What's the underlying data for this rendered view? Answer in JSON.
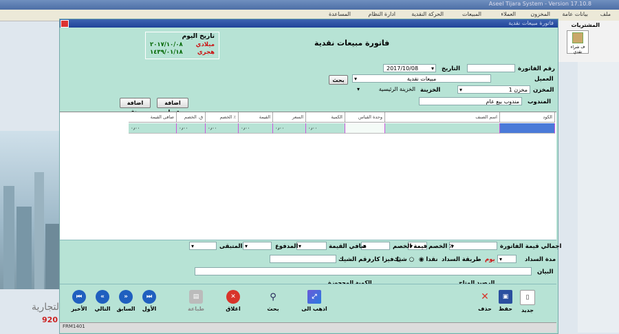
{
  "bg": {
    "title": "Aseel Tijara System - Version 17.10.8",
    "menu": [
      "ملف",
      "بيانات عامة",
      "المخزون",
      "العملاء",
      "المبيعات",
      "الحركة النقدية",
      "ادارة النظام",
      "المساعدة"
    ],
    "toolbar_label": "المشتريات",
    "toolbar_btn": "ف شراء نقدي",
    "brand_text": "لتجارية",
    "brand_phone": "920"
  },
  "dialog": {
    "caption": "فاتورة مبيعات نقدية",
    "title": "فاتورة مبيعات نقدية",
    "today": {
      "label": "تاريخ اليوم",
      "greg_label": "ميلادي",
      "greg_date": "٢٠١٧/١٠/٠٨",
      "hijri_label": "هجري",
      "hijri_date": "١٤٣٩/٠١/١٨"
    },
    "form": {
      "invoice_no_label": "رقم الفاتورة",
      "invoice_no": "",
      "date_label": "التاريخ",
      "date_value": "2017/10/08",
      "customer_label": "العميل",
      "customer_value": "مبيعات نقدية",
      "search_btn": "بحث",
      "store_label": "المخزن",
      "store_value": "مخزن 1",
      "treasury_label": "الخزينة",
      "treasury_value": "الخزينة الرئيسية",
      "rep_label": "المندوب",
      "rep_value": "مندوب بيع عام",
      "add_customer_btn": "اضافة عميل",
      "add_item_btn": "اضافة صنف"
    },
    "grid": {
      "headers": [
        "الكود",
        "اسم الصنف",
        "وحدة القياس",
        "الكمية",
        "السعر",
        "القيمة",
        "الخصم ٪",
        "ق. الخصم",
        "صافى القيمة"
      ],
      "row": [
        "",
        "",
        "",
        "٠٫٠٠",
        "٠٫٠٠",
        "٠٫٠٠",
        "٠٫٠٠",
        "٠٫٠٠",
        "٠٫٠٠"
      ]
    },
    "totals": {
      "total_label": "اجمالي قيمة الفاتورة",
      "discount_pct_label": "الخصم ٪",
      "discount_val_label": "قيمة الخصم",
      "net_label": "صافي القيمة",
      "paid_label": "المدفوع",
      "remaining_label": "المتبقى",
      "duration_label": "مدة السداد",
      "day_label": "يوم",
      "pay_method_label": "طريقة السداد",
      "cash_label": "نقدا",
      "cheque_label": "شيك",
      "visa_label": "فيزا كارد",
      "cheque_no_label": "رقم الشيك",
      "notes_label": "البيان",
      "balance_label": "الرصيد المتاح",
      "reserved_label": "الكمية المحجوزة"
    },
    "toolbar": {
      "new": "جديد",
      "save": "حفظ",
      "delete": "حذف",
      "goto": "اذهب الى",
      "search": "بحث",
      "close": "اغلاق",
      "print": "طباعة",
      "first": "الأول",
      "prev": "السابق",
      "next": "التالي",
      "last": "الأخير"
    },
    "status": "FRM1401"
  },
  "colors": {
    "dialog_bg": "#b7e3d5",
    "title_bar": "#20439a",
    "nav_blue": "#1f5fbf",
    "close_red": "#d8342a",
    "highlight": "#4a7ad8"
  }
}
